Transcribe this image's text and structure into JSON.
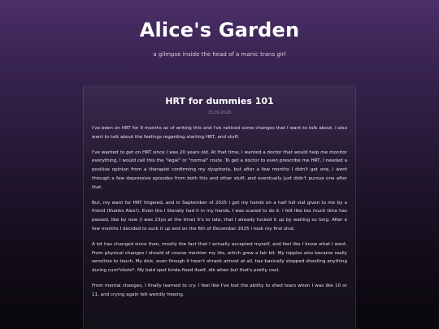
{
  "site": {
    "title": "Alice's Garden",
    "tagline": "a glimpse inside the head of a manic trans girl"
  },
  "post": {
    "title": "HRT for dummies 101",
    "date": "15.09.2026",
    "paragraphs": [
      "I've been on HRT for 9 months as of writing this and I've noticed some changes that I want to talk about, I also want to talk about the feelings regarding starting HRT, and stuff.",
      "I've wanted to get on HRT since I was 20 years old. At that time, I wanted a doctor that would help me monitor everything, I would call this the \"legal\" or \"normal\" route. To get a doctor to even prescribe me HRT, I needed a positive opinion from a therapist confirming my dysphoria, but after a few months I didn't get one, I went through a few depressive episodes from both this and other stuff, and eventually just didn't pursue one after that.",
      "But, my want for HRT lingered, and in September of 2025 I got my hands on a half full vial given to me by a friend (thanks Alex!). Even tho I literally had it in my hands, I was scared to do it. I felt like too much time has passed, like by now (I was 23yo at the time) it's to late, that I already fucked it up by waiting so long. After a few months I decided to suck it up and on the 6th of December 2025 I took my first shot.",
      "A lot has changed since then, mostly the fact that I actually accepted myself, and feel like I know what I want. From physical changes I should of course mention my tits, which grew a fair bit. My nipples also became really sensitive to touch. My dick, even though it hasn't shrank almost at all, has basically stopped shooting anything during cum*shots*. My bald spot kinda fixed itself, idk when but that's pretty cool.",
      "From mental changes, I finally learned to cry. I feel like I've lost the ability to shed tears when I was like 10 or 11, and crying again felt weirdly freeing."
    ]
  }
}
